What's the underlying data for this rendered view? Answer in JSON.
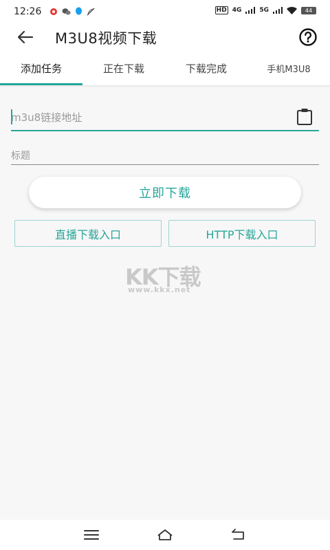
{
  "status_bar": {
    "time": "12:26",
    "network_labels": [
      "HD",
      "4G",
      "5G"
    ],
    "battery": "44"
  },
  "app_bar": {
    "title": "M3U8视频下载",
    "back_icon": "arrow-left-icon",
    "help_icon": "help-circle-icon"
  },
  "tabs": [
    {
      "label": "添加任务",
      "active": true
    },
    {
      "label": "正在下载",
      "active": false
    },
    {
      "label": "下载完成",
      "active": false
    },
    {
      "label": "手机M3U8",
      "active": false
    }
  ],
  "form": {
    "url_placeholder": "m3u8链接地址",
    "url_value": "",
    "title_placeholder": "标题",
    "title_value": "",
    "paste_icon": "clipboard-icon"
  },
  "buttons": {
    "download_now": "立即下载",
    "live_entry": "直播下载入口",
    "http_entry": "HTTP下载入口"
  },
  "watermark": {
    "logo_text": "KK下载",
    "url": "www.kkx.net"
  },
  "colors": {
    "accent": "#26a69a",
    "background": "#f7f7f7"
  },
  "nav_bar": {
    "icons": [
      "menu-icon",
      "home-icon",
      "back-icon"
    ]
  }
}
